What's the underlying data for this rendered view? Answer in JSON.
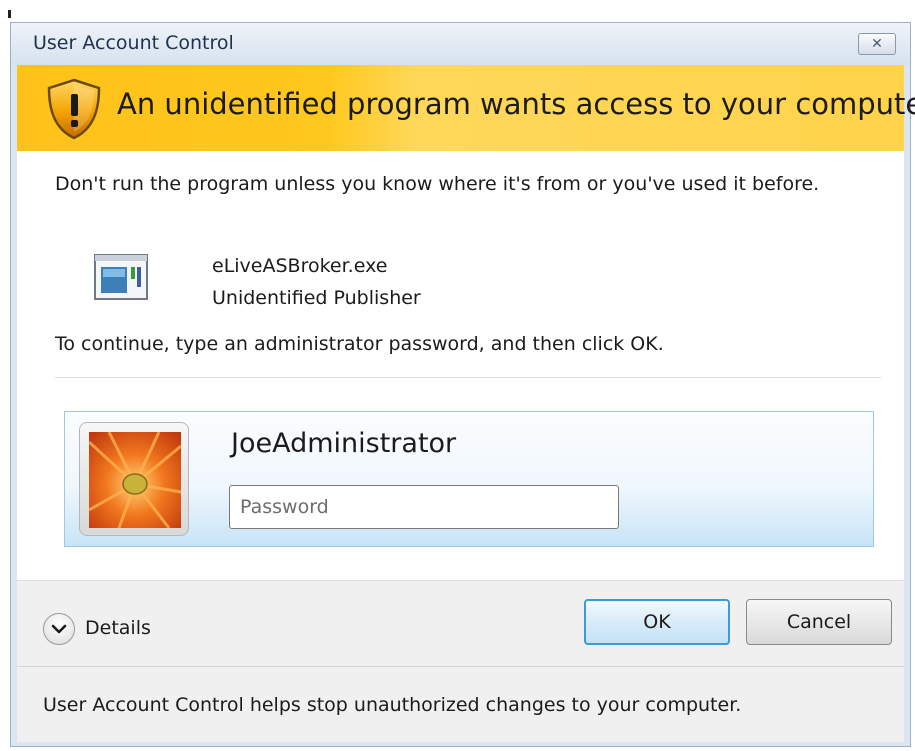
{
  "window": {
    "title": "User Account Control",
    "close_label": "✕"
  },
  "banner": {
    "text": "An unidentified program wants access to your computer",
    "icon": "shield-warning-icon"
  },
  "warning": "Don't run the program unless you know where it's from or you've used it before.",
  "program": {
    "name": "eLiveASBroker.exe",
    "publisher": "Unidentified Publisher",
    "icon": "application-icon"
  },
  "instructions": "To continue, type an administrator password, and then click OK.",
  "credential": {
    "username": "JoeAdministrator",
    "password_placeholder": "Password",
    "password_value": "",
    "avatar_icon": "flower-avatar"
  },
  "details": {
    "label": "Details",
    "icon": "chevron-down-icon"
  },
  "buttons": {
    "ok": "OK",
    "cancel": "Cancel"
  },
  "footer": "User Account Control helps stop unauthorized changes to your computer.",
  "colors": {
    "banner": "#ffc81e",
    "tile_border": "#9cc9ea",
    "ok_border": "#3c9ad8"
  }
}
